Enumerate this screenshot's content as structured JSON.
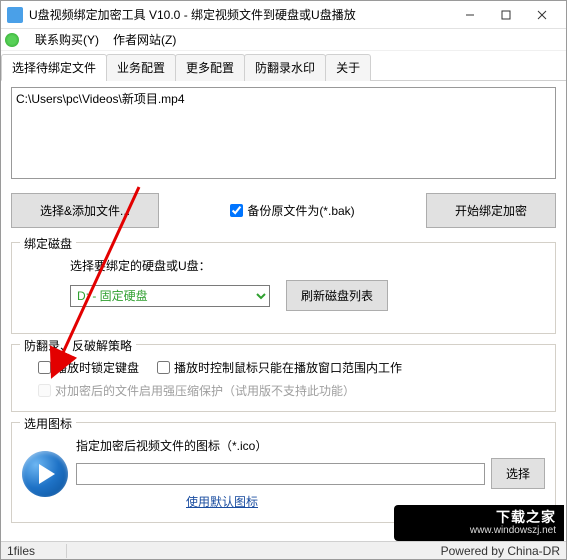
{
  "window": {
    "title": "U盘视频绑定加密工具 V10.0 - 绑定视频文件到硬盘或U盘播放"
  },
  "menu": {
    "contact": "联系购买(Y)",
    "site": "作者网站(Z)"
  },
  "tabs": [
    {
      "label": "选择待绑定文件",
      "active": true
    },
    {
      "label": "业务配置",
      "active": false
    },
    {
      "label": "更多配置",
      "active": false
    },
    {
      "label": "防翻录水印",
      "active": false
    },
    {
      "label": "关于",
      "active": false
    }
  ],
  "filelist": "C:\\Users\\pc\\Videos\\新项目.mp4",
  "buttons": {
    "add_file": "选择&添加文件...",
    "backup_chk": "备份原文件为(*.bak)",
    "start": "开始绑定加密",
    "refresh_disk": "刷新磁盘列表",
    "choose_icon": "选择"
  },
  "group_disk": {
    "legend": "绑定磁盘",
    "prompt": "选择要绑定的硬盘或U盘：",
    "selected": "D: - 固定硬盘",
    "options": [
      "D: - 固定硬盘"
    ]
  },
  "group_policy": {
    "legend": "防翻录、反破解策略",
    "lock_keyboard": "播放时锁定键盘",
    "lock_mouse": "播放时控制鼠标只能在播放窗口范围内工作",
    "compress_disabled": "对加密后的文件启用强压缩保护（试用版不支持此功能）"
  },
  "group_icon": {
    "legend": "选用图标",
    "prompt": "指定加密后视频文件的图标（*.ico）",
    "value": "",
    "default_link": "使用默认图标"
  },
  "status": {
    "left": "1files",
    "right": "Powered by China-DR"
  },
  "watermark": {
    "big": "下载之家",
    "small": "www.windowszj.net"
  }
}
